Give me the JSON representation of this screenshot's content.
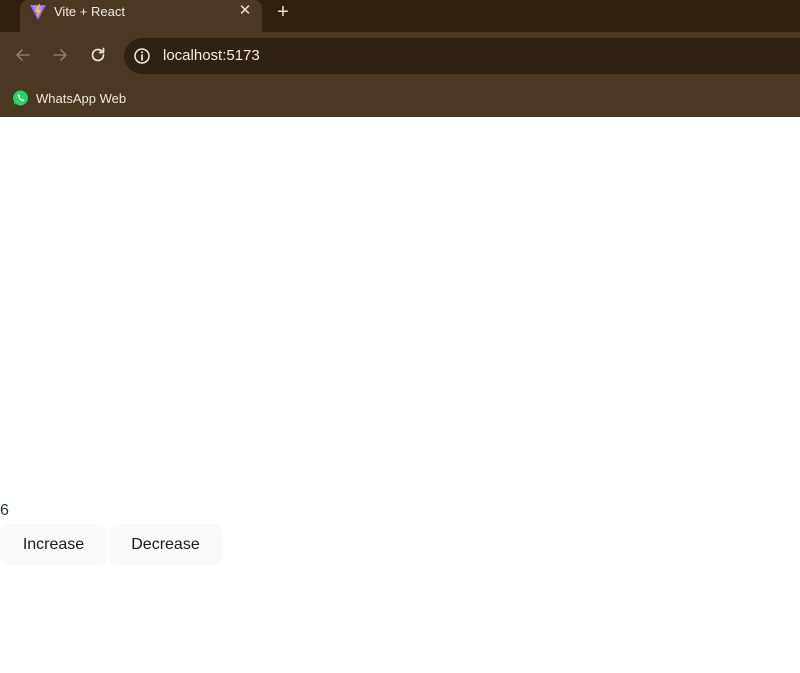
{
  "browser": {
    "tab": {
      "title": "Vite + React",
      "close_glyph": "✕",
      "favicon": "vite-logo-icon"
    },
    "new_tab_glyph": "+",
    "toolbar": {
      "back_icon": "arrow-left-icon",
      "forward_icon": "arrow-right-icon",
      "reload_icon": "reload-icon",
      "site_info_icon": "info-icon"
    },
    "address": "localhost:5173",
    "bookmarks": [
      {
        "label": "WhatsApp Web",
        "icon": "whatsapp-icon"
      }
    ]
  },
  "app": {
    "count": "6",
    "increase_label": "Increase",
    "decrease_label": "Decrease"
  },
  "colors": {
    "tabstrip": "#2e200f",
    "toolbar": "#4a3823",
    "omnibox": "#2f2213",
    "button_bg": "#f9f9f9",
    "count_text": "#213547"
  }
}
